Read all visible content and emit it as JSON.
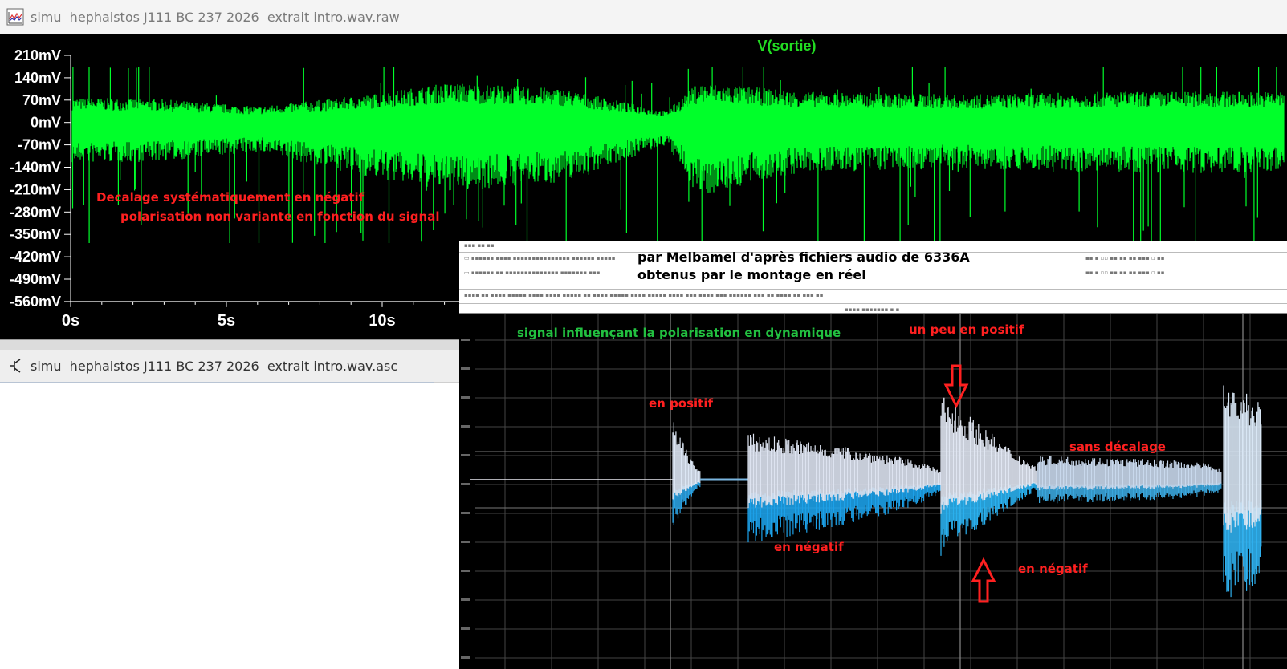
{
  "window1": {
    "title": "simu  hephaistos J111 BC 237 2026  extrait intro.wav.raw"
  },
  "window2": {
    "title": "simu  hephaistos J111 BC 237 2026  extrait intro.wav.asc"
  },
  "plot": {
    "trace_name": "V(sortie)",
    "y_ticks": [
      "210mV",
      "140mV",
      "70mV",
      "0mV",
      "-70mV",
      "-140mV",
      "-210mV",
      "-280mV",
      "-350mV",
      "-420mV",
      "-490mV",
      "-560mV"
    ],
    "x_ticks": [
      "0s",
      "5s",
      "10s"
    ],
    "trace_color": "#00ff2a"
  },
  "annotations_top": {
    "line1": "Decalage systématiquement en négatif",
    "line2": "polarisation non variante  en fonction du signal"
  },
  "inset": {
    "credit_line1": "par Melbamel d'après fichiers audio de 6336A",
    "credit_line2": "obtenus par le montage en réel",
    "signal_note": "signal influençant la polarisation en dynamique",
    "label_pos1": "en positif",
    "label_neg1": "en négatif",
    "label_pos2": "un peu en positif",
    "label_neg2": "en négatif",
    "label_none": "sans décalage"
  }
}
